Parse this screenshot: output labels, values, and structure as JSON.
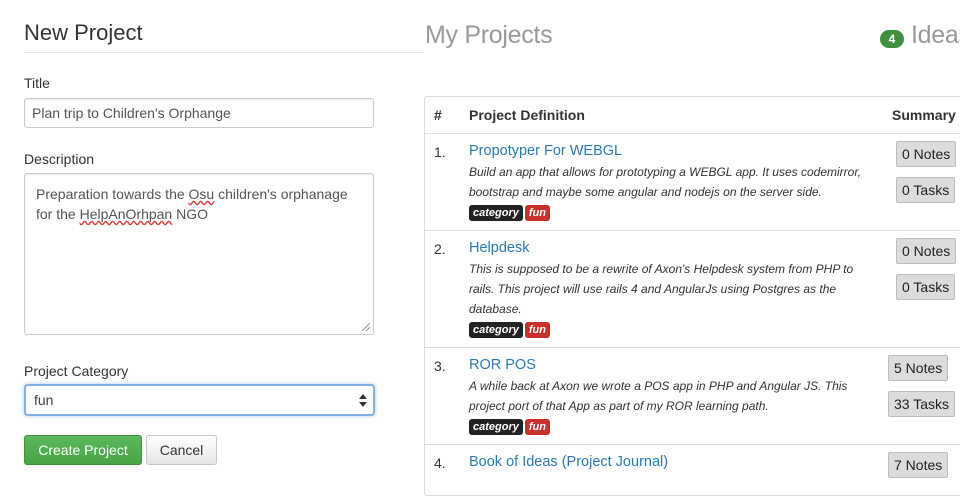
{
  "form": {
    "heading": "New Project",
    "title_label": "Title",
    "title_value": "Plan trip to Children's Orphange",
    "description_label": "Description",
    "description_parts": [
      "Preparation towards the ",
      "Osu",
      " children's orphanage",
      "for the ",
      "HelpAnOrhpan",
      " NGO"
    ],
    "category_label": "Project Category",
    "category_value": "fun",
    "create_label": "Create Project",
    "cancel_label": "Cancel"
  },
  "projects": {
    "heading": "My Projects",
    "ideas_count": "4",
    "ideas_label": "Ideas",
    "columns": [
      "#",
      "Project Definition",
      "Summary"
    ],
    "rows": [
      {
        "num": "1.",
        "name": "Propotyper For WEBGL",
        "description": [
          "Build an app that allows for prototyping a WEBGL app. It uses codemirror,",
          "bootstrap and maybe some angular and nodejs on the server side."
        ],
        "tags": [
          "category",
          "fun"
        ],
        "notes": "0 Notes",
        "tasks": "0 Tasks"
      },
      {
        "num": "2.",
        "name": "Helpdesk",
        "description": [
          "This is supposed to be a rewrite of Axon's Helpdesk system from PHP to",
          "rails. This project will use rails 4 and AngularJs using Postgres as the",
          "database."
        ],
        "tags": [
          "category",
          "fun"
        ],
        "notes": "0 Notes",
        "tasks": "0 Tasks"
      },
      {
        "num": "3.",
        "name": "ROR POS",
        "description": [
          "A while back at Axon we wrote a POS app in PHP and Angular JS. This",
          "project port of that App as part of my ROR learning path."
        ],
        "tags": [
          "category",
          "fun"
        ],
        "notes": "5 Notes",
        "tasks": "33 Tasks"
      },
      {
        "num": "4.",
        "name": "Book of Ideas (Project Journal)",
        "notes": "7 Notes"
      }
    ]
  },
  "colors": {
    "link": "#2a7ab8",
    "primary_button": "#5cb85c",
    "tag_category": "#222222",
    "tag_fun": "#c9302c",
    "ideas_badge": "#3e8f3e"
  }
}
